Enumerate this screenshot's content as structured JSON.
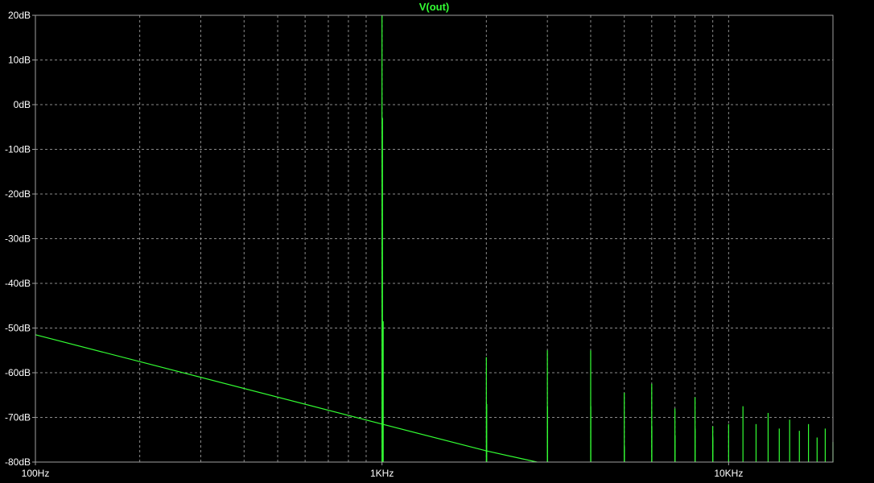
{
  "chart_data": {
    "type": "line",
    "title": "V(out)",
    "xscale": "log",
    "xlim": [
      100,
      20000
    ],
    "ylim": [
      -80,
      20
    ],
    "grid": true,
    "y_ticks": [
      {
        "value": 20,
        "label": "20dB"
      },
      {
        "value": 10,
        "label": "10dB"
      },
      {
        "value": 0,
        "label": "0dB"
      },
      {
        "value": -10,
        "label": "-10dB"
      },
      {
        "value": -20,
        "label": "-20dB"
      },
      {
        "value": -30,
        "label": "-30dB"
      },
      {
        "value": -40,
        "label": "-40dB"
      },
      {
        "value": -50,
        "label": "-50dB"
      },
      {
        "value": -60,
        "label": "-60dB"
      },
      {
        "value": -70,
        "label": "-70dB"
      },
      {
        "value": -80,
        "label": "-80dB"
      }
    ],
    "x_ticks": [
      {
        "value": 100,
        "label": "100Hz"
      },
      {
        "value": 1000,
        "label": "1KHz"
      },
      {
        "value": 10000,
        "label": "10KHz"
      }
    ],
    "noise_floor": [
      {
        "x": 100,
        "y": -51.5
      },
      {
        "x": 1000,
        "y": -71.5
      },
      {
        "x": 2000,
        "y": -77.5
      },
      {
        "x": 2800,
        "y": -80.5
      }
    ],
    "peaks": [
      {
        "x": 1000,
        "y": 20
      },
      {
        "x": 1003,
        "y": -3
      },
      {
        "x": 1008,
        "y": -48.5
      },
      {
        "x": 2000,
        "y": -56.5
      },
      {
        "x": 2005,
        "y": -67
      },
      {
        "x": 3000,
        "y": -55
      },
      {
        "x": 3003,
        "y": -67.5
      },
      {
        "x": 4000,
        "y": -55
      },
      {
        "x": 4003,
        "y": -67.5
      },
      {
        "x": 5000,
        "y": -64.5
      },
      {
        "x": 5005,
        "y": -76.5
      },
      {
        "x": 6000,
        "y": -62.5
      },
      {
        "x": 6005,
        "y": -72
      },
      {
        "x": 7000,
        "y": -68
      },
      {
        "x": 7005,
        "y": -74
      },
      {
        "x": 8000,
        "y": -65.5
      },
      {
        "x": 8005,
        "y": -72.5
      },
      {
        "x": 9000,
        "y": -72
      },
      {
        "x": 9005,
        "y": -74.5
      },
      {
        "x": 10000,
        "y": -71.5
      },
      {
        "x": 11000,
        "y": -67.5
      },
      {
        "x": 12000,
        "y": -71.5
      },
      {
        "x": 13000,
        "y": -69
      },
      {
        "x": 14000,
        "y": -72.5
      },
      {
        "x": 15000,
        "y": -70.5
      },
      {
        "x": 16000,
        "y": -73
      },
      {
        "x": 17000,
        "y": -71.5
      },
      {
        "x": 18000,
        "y": -74.5
      },
      {
        "x": 19000,
        "y": -72.5
      },
      {
        "x": 20000,
        "y": -75.5
      }
    ],
    "colors": {
      "trace": "#33ff33",
      "grid": "#8a8a8a",
      "axis": "#a0a0a0",
      "background": "#000000",
      "labels": "#ffffff"
    }
  }
}
